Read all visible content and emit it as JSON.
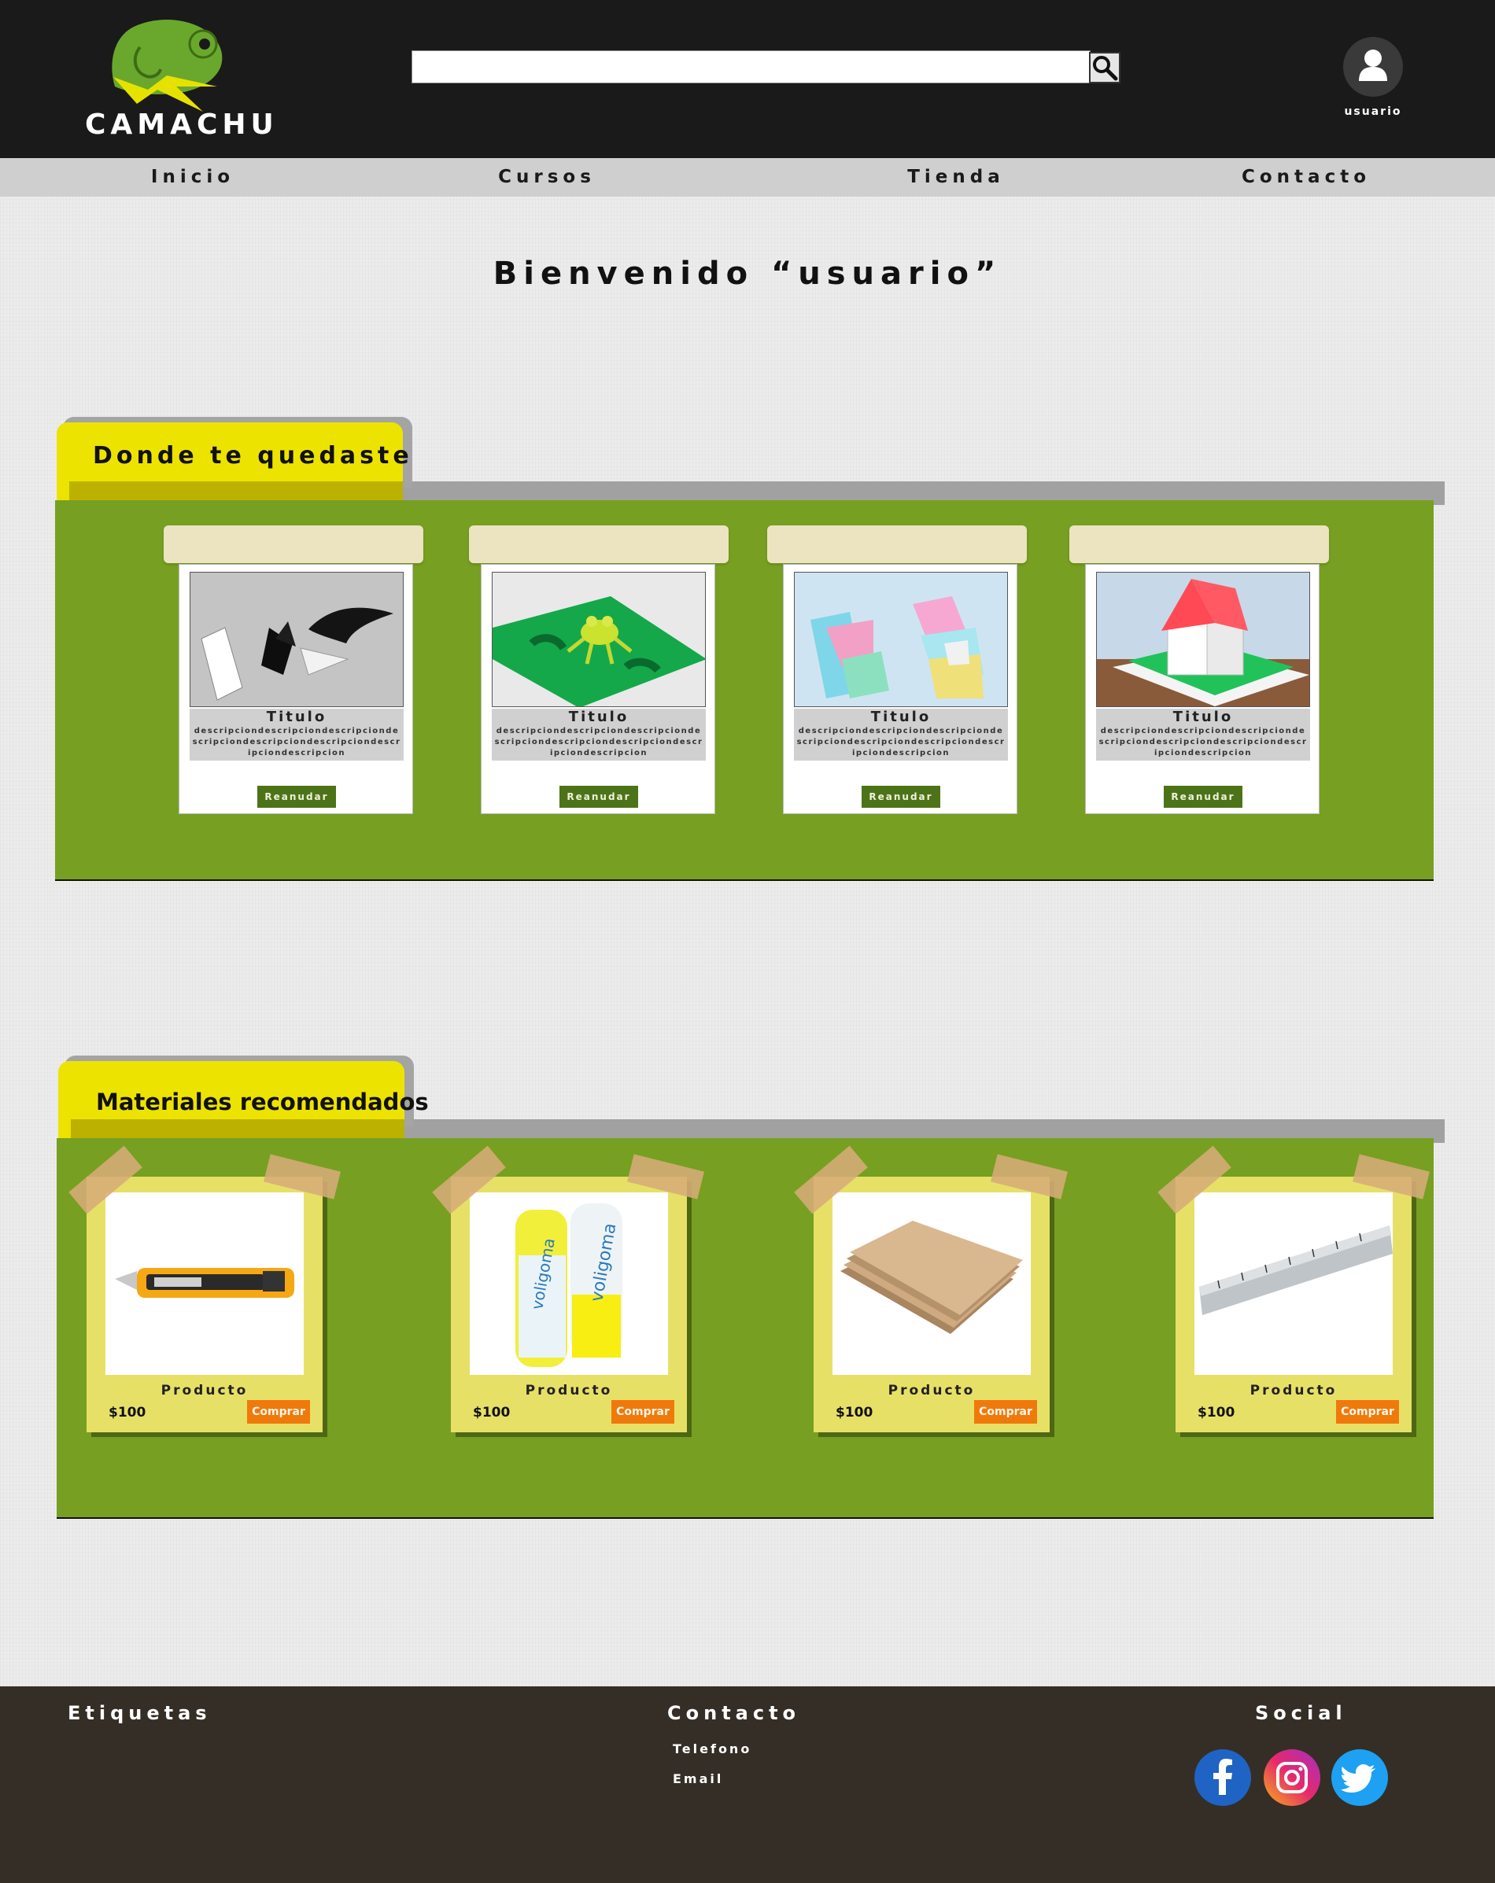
{
  "brand": {
    "name": "CAMACHU"
  },
  "search": {
    "value": "",
    "placeholder": ""
  },
  "user": {
    "label": "usuario"
  },
  "nav": {
    "items": [
      "Inicio",
      "Cursos",
      "Tienda",
      "Contacto"
    ]
  },
  "welcome": {
    "text": "Bienvenido “usuario”"
  },
  "resume_section": {
    "title": "Donde te quedaste",
    "courses": [
      {
        "title": "Titulo",
        "description": "descripciondescripciondescripciondescripciondescripciondescripciondescripciondescripcion",
        "button": "Reanudar",
        "image": "black-popup-figures"
      },
      {
        "title": "Titulo",
        "description": "descripciondescripciondescripciondescripciondescripciondescripciondescripciondescripcion",
        "button": "Reanudar",
        "image": "frog-on-leaf-popup"
      },
      {
        "title": "Titulo",
        "description": "descripciondescripciondescripciondescripciondescripciondescripciondescripciondescripcion",
        "button": "Reanudar",
        "image": "colorful-popup-shapes"
      },
      {
        "title": "Titulo",
        "description": "descripciondescripciondescripciondescripciondescripciondescripciondescripciondescripcion",
        "button": "Reanudar",
        "image": "house-popup-book"
      }
    ]
  },
  "materials_section": {
    "title": "Materiales recomendados",
    "products": [
      {
        "name": "Producto",
        "price": "$100",
        "button": "Comprar",
        "image": "utility-knife"
      },
      {
        "name": "Producto",
        "price": "$100",
        "button": "Comprar",
        "image": "glue-bottles"
      },
      {
        "name": "Producto",
        "price": "$100",
        "button": "Comprar",
        "image": "cardboard-sheets"
      },
      {
        "name": "Producto",
        "price": "$100",
        "button": "Comprar",
        "image": "metal-ruler"
      }
    ]
  },
  "footer": {
    "tags_heading": "Etiquetas",
    "contact_heading": "Contacto",
    "contact_phone": "Telefono",
    "contact_email": "Email",
    "social_heading": "Social",
    "social_icons": [
      "facebook-icon",
      "instagram-icon",
      "twitter-icon"
    ]
  },
  "colors": {
    "header_bg": "#1a1a1a",
    "nav_bg": "#cfcfcf",
    "folder_tab": "#ede300",
    "panel_green": "#779f21",
    "resume_button": "#4d7318",
    "buy_button": "#ef7a0b",
    "product_card": "#e7e067",
    "footer_bg": "#352e26",
    "logo_green": "#6aa82d",
    "logo_yellow": "#e5e200"
  }
}
